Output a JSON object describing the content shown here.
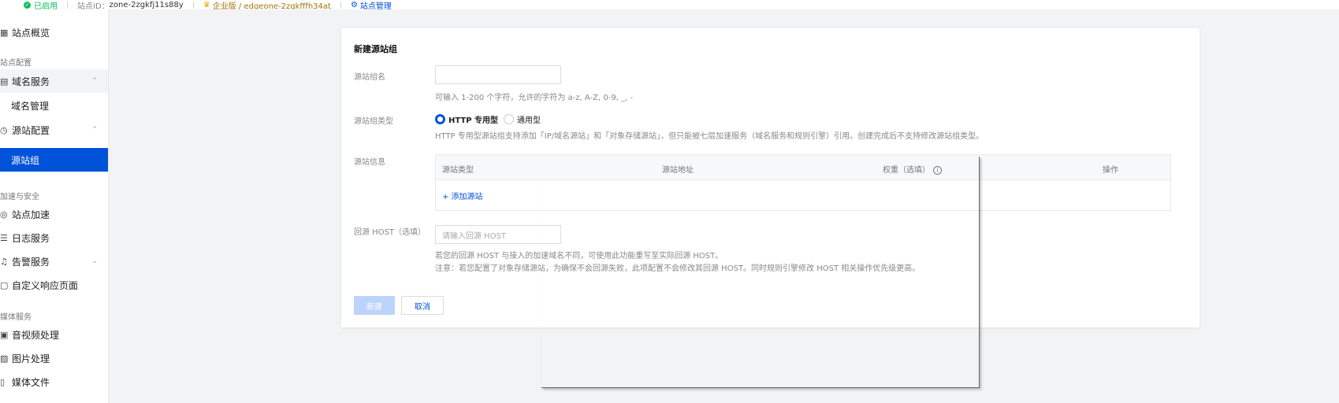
{
  "topbar": {
    "status": "已启用",
    "zone_label": "站点ID：",
    "zone_id": "zone-2zgkfj11s88y",
    "edition": "企业版 / edgeone-2zgkfffh34at",
    "manage": "站点管理"
  },
  "sidebar": {
    "overview": "站点概览",
    "group_site_config": "站点配置",
    "domain_service": "域名服务",
    "domain_manage": "域名管理",
    "origin_config": "源站配置",
    "origin_group": "源站组",
    "group_accel_security": "加速与安全",
    "site_accel": "站点加速",
    "log_service": "日志服务",
    "alert_service": "告警服务",
    "custom_page": "自定义响应页面",
    "group_media": "媒体服务",
    "av_processing": "音视频处理",
    "image_processing": "图片处理",
    "media_files": "媒体文件"
  },
  "form": {
    "title": "新建源站组",
    "name_label": "源站组名",
    "name_value": "",
    "name_help": "可输入 1-200 个字符，允许的字符为 a-z, A-Z, 0-9, _, -",
    "type_label": "源站组类型",
    "type_options": [
      "HTTP 专用型",
      "通用型"
    ],
    "type_selected": "HTTP 专用型",
    "type_help": "HTTP 专用型源站组支持添加「IP/域名源站」和「对象存储源站」，但只能被七层加速服务（域名服务和规则引擎）引用。创建完成后不支持修改源站组类型。",
    "info_label": "源站信息",
    "table": {
      "columns": [
        "源站类型",
        "源站地址",
        "权重（选填）",
        "操作"
      ],
      "add_link": "+ 添加源站"
    },
    "host_label": "回源 HOST（选填）",
    "host_placeholder": "请输入回源 HOST",
    "host_help_1": "若您的回源 HOST 与接入的加速域名不同，可使用此功能重写至实际回源 HOST。",
    "host_help_2": "注意：若您配置了对象存储源站，为确保不会回源失败，此项配置不会修改其回源 HOST。同时规则引擎修改 HOST 相关操作优先级更高。",
    "submit": "新建",
    "cancel": "取消"
  },
  "colors": {
    "primary": "#0052d9",
    "success": "#0abf5b",
    "disabled_primary": "#bcd4fb"
  }
}
